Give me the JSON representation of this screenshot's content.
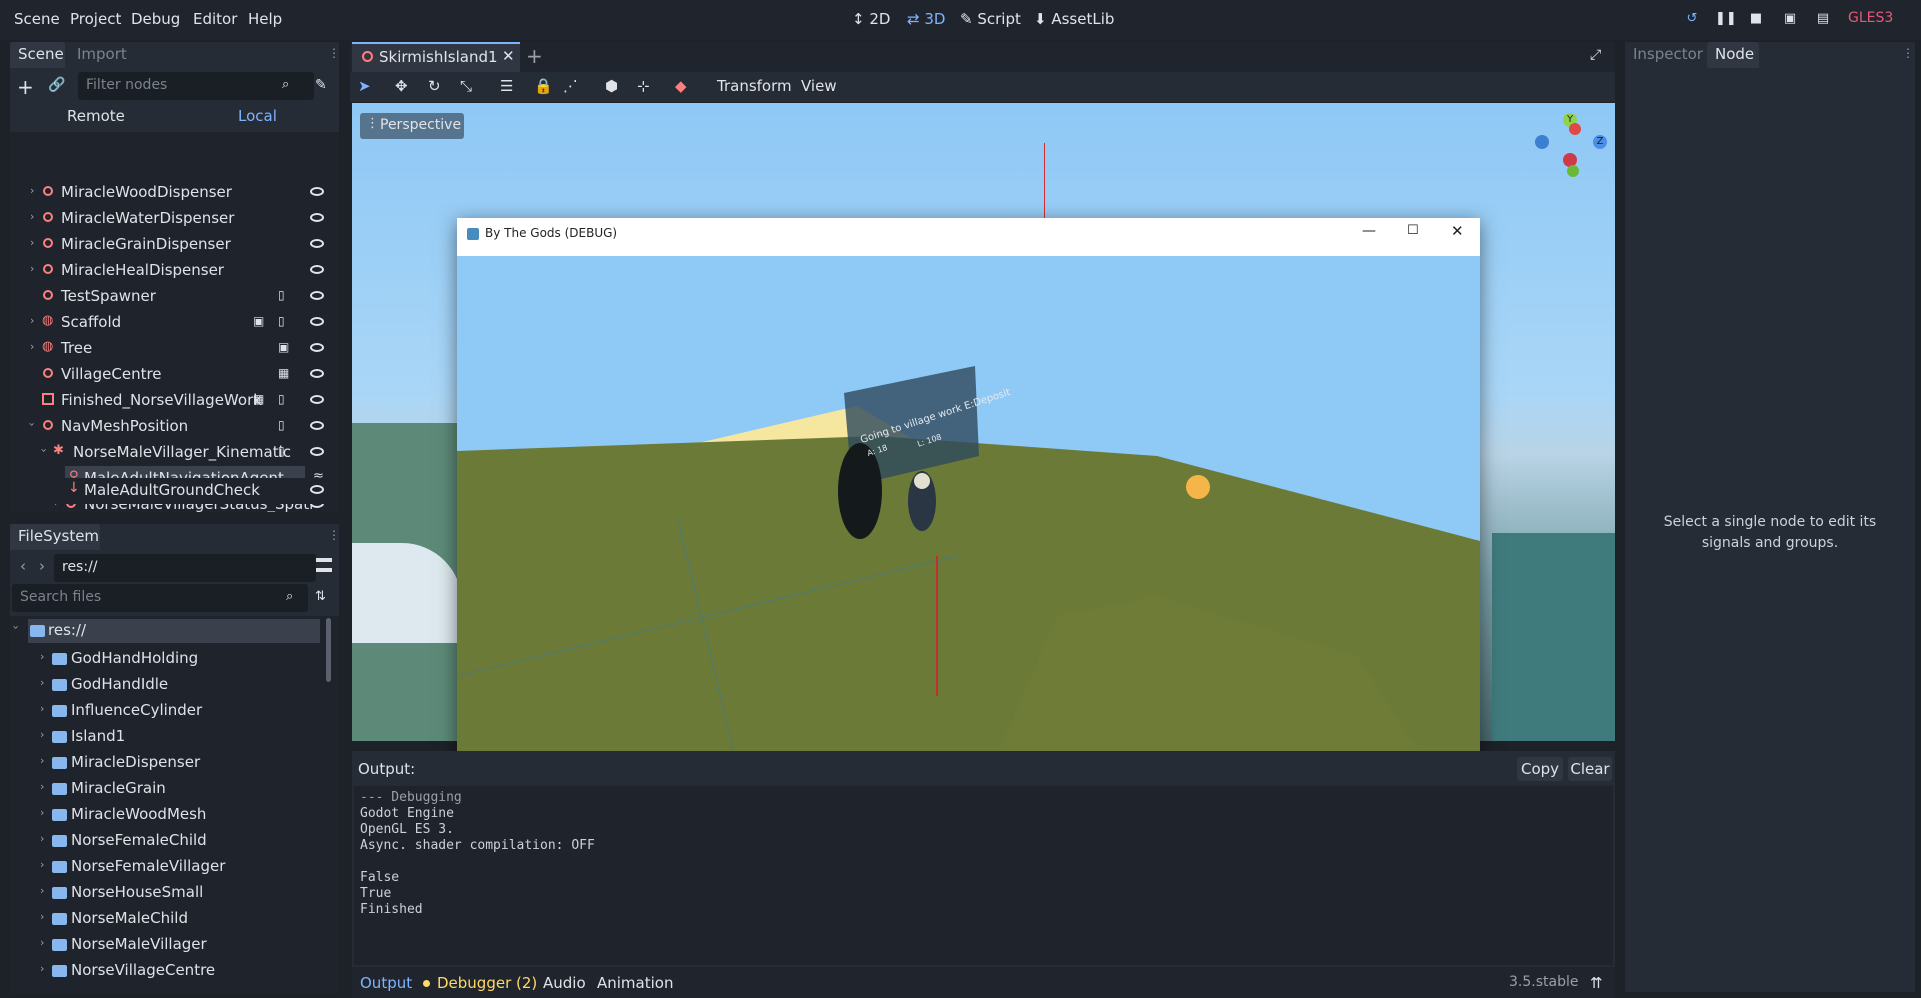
{
  "menubar": {
    "menus": [
      "Scene",
      "Project",
      "Debug",
      "Editor",
      "Help"
    ],
    "workspaces": [
      "2D",
      "3D",
      "Script",
      "AssetLib"
    ],
    "renderer": "GLES3"
  },
  "scene_dock": {
    "tabs": [
      "Scene",
      "Import"
    ],
    "filter_placeholder": "Filter nodes",
    "remote_label": "Remote",
    "local_label": "Local",
    "nodes": [
      {
        "label": "MiracleWoodDispenser"
      },
      {
        "label": "MiracleWaterDispenser"
      },
      {
        "label": "MiracleGrainDispenser"
      },
      {
        "label": "MiracleHealDispenser"
      },
      {
        "label": "TestSpawner"
      },
      {
        "label": "Scaffold"
      },
      {
        "label": "Tree"
      },
      {
        "label": "VillageCentre"
      },
      {
        "label": "Finished_NorseVillageWork"
      },
      {
        "label": "NavMeshPosition"
      },
      {
        "label": "NorseMaleVillager_Kinematic"
      },
      {
        "label": "MaleAdultNavigationAgent"
      },
      {
        "label": "NorseMaleVillagerStatus_Spati"
      },
      {
        "label": "MaleAdultGroundCheck"
      }
    ]
  },
  "filesystem_dock": {
    "title": "FileSystem",
    "path": "res://",
    "search_placeholder": "Search files",
    "root": "res://",
    "folders": [
      "GodHandHolding",
      "GodHandIdle",
      "InfluenceCylinder",
      "Island1",
      "MiracleDispenser",
      "MiracleGrain",
      "MiracleWoodMesh",
      "NorseFemaleChild",
      "NorseFemaleVillager",
      "NorseHouseSmall",
      "NorseMaleChild",
      "NorseMaleVillager",
      "NorseVillageCentre"
    ]
  },
  "editor": {
    "scene_tab": "SkirmishIsland1",
    "toolbar_menus": [
      "Transform",
      "View"
    ],
    "viewport_label": "Perspective",
    "gizmo_axes": [
      "Y",
      "Z"
    ]
  },
  "game_window": {
    "title": "By The Gods (DEBUG)",
    "banner_text": "Going to village work E:Deposit",
    "banner_sub1": "A: 18",
    "banner_sub2": "L: 108"
  },
  "output_panel": {
    "title": "Output:",
    "copy_label": "Copy",
    "clear_label": "Clear",
    "lines": [
      "--- Debugging",
      "Godot Engine",
      "OpenGL ES 3.",
      "Async. shader compilation: OFF",
      "",
      "False",
      "True",
      "Finished"
    ]
  },
  "bottom_bar": {
    "tabs": [
      "Output",
      "Debugger (2)",
      "Audio",
      "Animation"
    ],
    "version": "3.5.stable"
  },
  "inspector_dock": {
    "tabs": [
      "Inspector",
      "Node"
    ],
    "message": "Select a single node to edit its signals and groups."
  },
  "colors": {
    "accent": "#7eb4ff",
    "node_red": "#fc7f7f",
    "debugger_yellow": "#ffd966",
    "gles": "#e8577a"
  }
}
